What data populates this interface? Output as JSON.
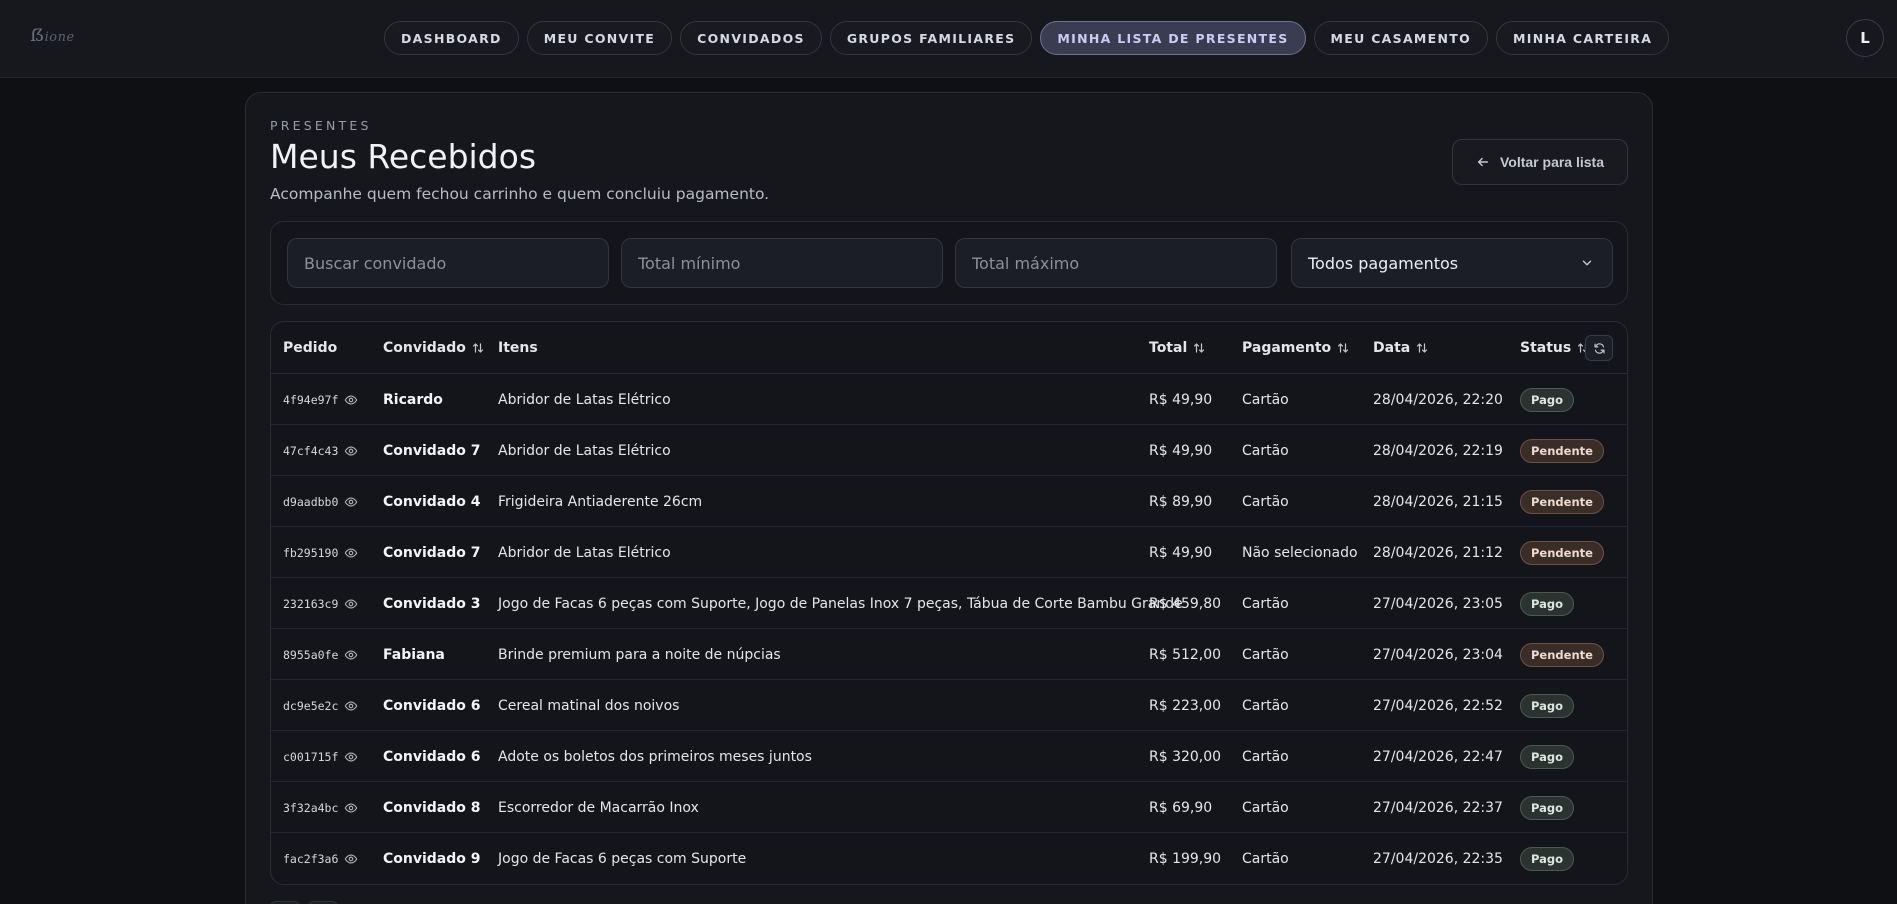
{
  "nav": {
    "items": [
      {
        "label": "DASHBOARD",
        "name": "nav-dashboard",
        "active": false
      },
      {
        "label": "MEU CONVITE",
        "name": "nav-meu-convite",
        "active": false
      },
      {
        "label": "CONVIDADOS",
        "name": "nav-convidados",
        "active": false
      },
      {
        "label": "GRUPOS FAMILIARES",
        "name": "nav-grupos-familiares",
        "active": false
      },
      {
        "label": "MINHA LISTA DE PRESENTES",
        "name": "nav-minha-lista-de-presentes",
        "active": true
      },
      {
        "label": "MEU CASAMENTO",
        "name": "nav-meu-casamento",
        "active": false
      },
      {
        "label": "MINHA CARTEIRA",
        "name": "nav-minha-carteira",
        "active": false
      }
    ],
    "avatar_initial": "L"
  },
  "header": {
    "eyebrow": "PRESENTES",
    "title": "Meus Recebidos",
    "subtitle": "Acompanhe quem fechou carrinho e quem concluiu pagamento.",
    "back_label": "Voltar para lista"
  },
  "filters": {
    "search_placeholder": "Buscar convidado",
    "min_placeholder": "Total mínimo",
    "max_placeholder": "Total máximo",
    "payment_select": "Todos pagamentos"
  },
  "table": {
    "columns": {
      "pedido": "Pedido",
      "convidado": "Convidado",
      "itens": "Itens",
      "total": "Total",
      "pagamento": "Pagamento",
      "data": "Data",
      "status": "Status"
    },
    "rows": [
      {
        "pedido": "4f94e97f",
        "convidado": "Ricardo",
        "itens": "Abridor de Latas Elétrico",
        "total": "R$ 49,90",
        "pagamento": "Cartão",
        "data": "28/04/2026, 22:20",
        "status": "Pago"
      },
      {
        "pedido": "47cf4c43",
        "convidado": "Convidado 7",
        "itens": "Abridor de Latas Elétrico",
        "total": "R$ 49,90",
        "pagamento": "Cartão",
        "data": "28/04/2026, 22:19",
        "status": "Pendente"
      },
      {
        "pedido": "d9aadbb0",
        "convidado": "Convidado 4",
        "itens": "Frigideira Antiaderente 26cm",
        "total": "R$ 89,90",
        "pagamento": "Cartão",
        "data": "28/04/2026, 21:15",
        "status": "Pendente"
      },
      {
        "pedido": "fb295190",
        "convidado": "Convidado 7",
        "itens": "Abridor de Latas Elétrico",
        "total": "R$ 49,90",
        "pagamento": "Não selecionado",
        "data": "28/04/2026, 21:12",
        "status": "Pendente"
      },
      {
        "pedido": "232163c9",
        "convidado": "Convidado 3",
        "itens": "Jogo de Facas 6 peças com Suporte, Jogo de Panelas Inox 7 peças, Tábua de Corte Bambu Grande",
        "total": "R$ 459,80",
        "pagamento": "Cartão",
        "data": "27/04/2026, 23:05",
        "status": "Pago"
      },
      {
        "pedido": "8955a0fe",
        "convidado": "Fabiana",
        "itens": "Brinde premium para a noite de núpcias",
        "total": "R$ 512,00",
        "pagamento": "Cartão",
        "data": "27/04/2026, 23:04",
        "status": "Pendente"
      },
      {
        "pedido": "dc9e5e2c",
        "convidado": "Convidado 6",
        "itens": "Cereal matinal dos noivos",
        "total": "R$ 223,00",
        "pagamento": "Cartão",
        "data": "27/04/2026, 22:52",
        "status": "Pago"
      },
      {
        "pedido": "c001715f",
        "convidado": "Convidado 6",
        "itens": "Adote os boletos dos primeiros meses juntos",
        "total": "R$ 320,00",
        "pagamento": "Cartão",
        "data": "27/04/2026, 22:47",
        "status": "Pago"
      },
      {
        "pedido": "3f32a4bc",
        "convidado": "Convidado 8",
        "itens": "Escorredor de Macarrão Inox",
        "total": "R$ 69,90",
        "pagamento": "Cartão",
        "data": "27/04/2026, 22:37",
        "status": "Pago"
      },
      {
        "pedido": "fac2f3a6",
        "convidado": "Convidado 9",
        "itens": "Jogo de Facas 6 peças com Suporte",
        "total": "R$ 199,90",
        "pagamento": "Cartão",
        "data": "27/04/2026, 22:35",
        "status": "Pago"
      }
    ]
  },
  "colors": {
    "background": "#0f1014",
    "card": "#16171c",
    "accent": "#6e7291",
    "pago": "#2b3330",
    "pendente": "#3a2c27"
  },
  "icons": {
    "view": "eye-icon",
    "sort": "sort-icon",
    "refresh": "refresh-icon",
    "back": "arrow-left-icon",
    "dropdown": "chevron-down-icon"
  }
}
